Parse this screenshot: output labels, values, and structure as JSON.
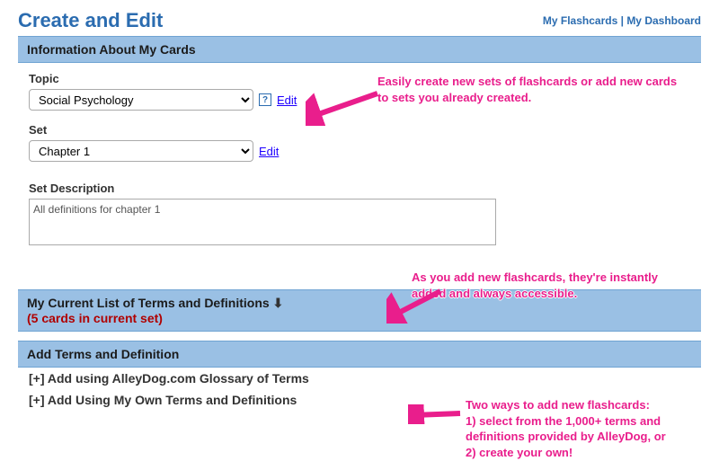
{
  "page": {
    "title": "Create and Edit"
  },
  "topLinks": {
    "flashcards": "My Flashcards",
    "dashboard": "My Dashboard",
    "separator": "|"
  },
  "sections": {
    "info": "Information About My Cards",
    "list": "My Current List of Terms and Definitions",
    "listCount": "(5 cards in current set)",
    "add": "Add Terms and Definition"
  },
  "form": {
    "topicLabel": "Topic",
    "topicValue": "Social Psychology",
    "editLink": "Edit",
    "helpGlyph": "?",
    "setLabel": "Set",
    "setValue": "Chapter 1",
    "descLabel": "Set Description",
    "descValue": "All definitions for chapter 1"
  },
  "addRows": {
    "glossary": "[+] Add using AlleyDog.com Glossary of Terms",
    "own": "[+] Add Using My Own Terms and Definitions"
  },
  "arrowGlyph": "⬇",
  "annotations": {
    "a1": "Easily create new sets of flashcards or add new cards to sets you already created.",
    "a2": "As you add new flashcards, they're instantly added and always accessible.",
    "a3": "Two ways to add new flashcards:\n1) select from the 1,000+ terms and definitions provided by AlleyDog, or\n2) create your own!"
  }
}
